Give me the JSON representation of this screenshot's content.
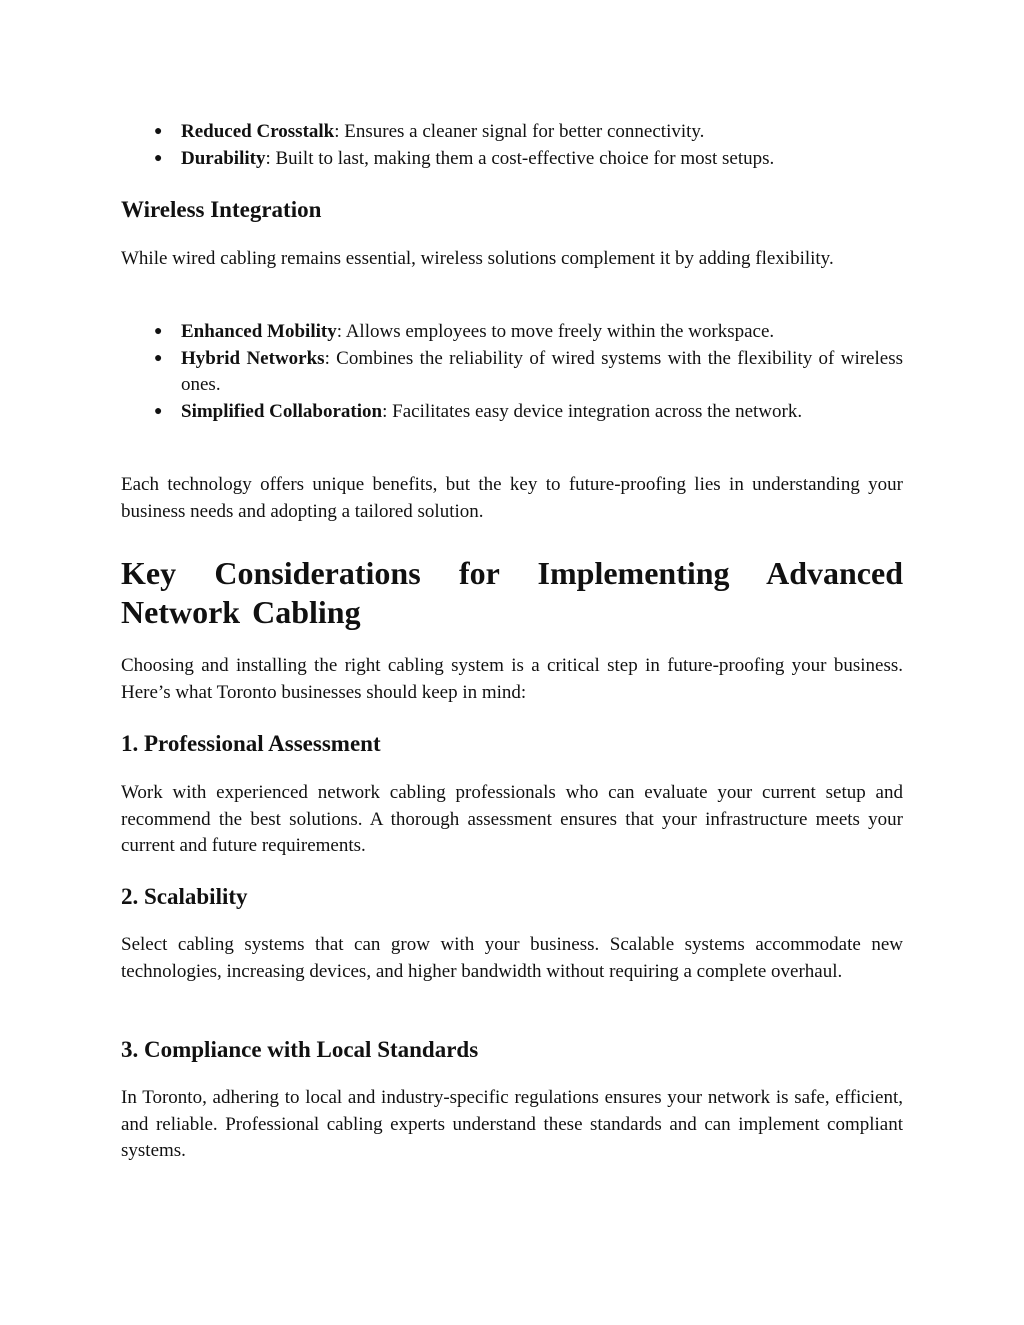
{
  "document": {
    "top_bullets": [
      {
        "term": "Reduced Crosstalk",
        "text": ": Ensures a cleaner signal for better connectivity."
      },
      {
        "term": "Durability",
        "text": ": Built to last, making them a cost-effective choice for most setups."
      }
    ],
    "wireless": {
      "heading": "Wireless Integration",
      "intro": "While wired cabling remains essential, wireless solutions complement it by adding flexibility.",
      "bullets": [
        {
          "term": "Enhanced Mobility",
          "text": ": Allows employees to move freely within the workspace."
        },
        {
          "term": "Hybrid Networks",
          "text": ": Combines the reliability of wired systems with the flexibility of wireless ones."
        },
        {
          "term": "Simplified Collaboration",
          "text": ": Facilitates easy device integration across the network."
        }
      ],
      "closing": "Each technology offers unique benefits, but the key to future-proofing lies in understanding your business needs and adopting a tailored solution."
    },
    "considerations": {
      "heading": "Key Considerations for Implementing Advanced Network Cabling",
      "intro": "Choosing and installing the right cabling system is a critical step in future-proofing your business. Here’s what Toronto businesses should keep in mind:",
      "sections": [
        {
          "heading": "1. Professional Assessment",
          "body": "Work with experienced network cabling professionals who can evaluate your current setup and recommend the best solutions. A thorough assessment ensures that your infrastructure meets your current and future requirements."
        },
        {
          "heading": "2. Scalability",
          "body": "Select cabling systems that can grow with your business. Scalable systems accommodate new technologies, increasing devices, and higher bandwidth without requiring a complete overhaul."
        },
        {
          "heading": "3. Compliance with Local Standards",
          "body": "In Toronto, adhering to local and industry-specific regulations ensures your network is safe, efficient, and reliable. Professional cabling experts understand these standards and can implement compliant systems."
        }
      ]
    },
    "bullet_glyph": "●"
  }
}
